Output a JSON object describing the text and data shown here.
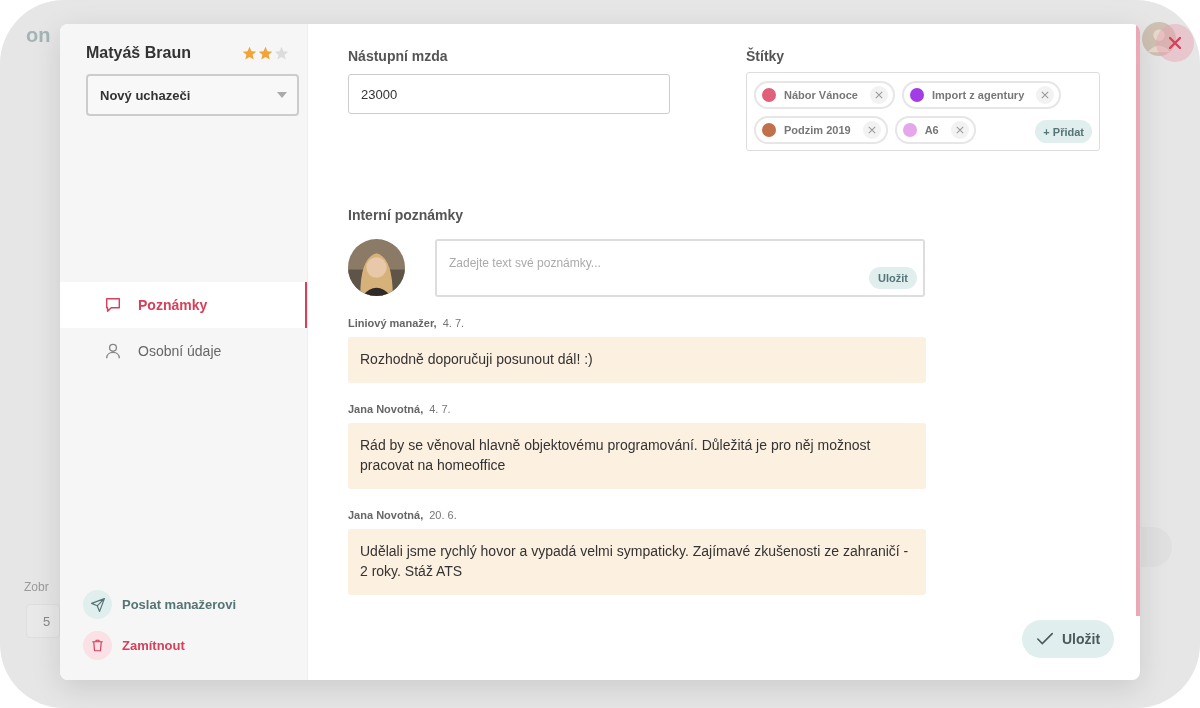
{
  "backdrop": {
    "logo": "on",
    "label": "Zobr",
    "select_value": "5"
  },
  "candidate": {
    "name": "Matyáš Braun",
    "stars": 2,
    "status": "Nový uchazeči"
  },
  "nav": [
    {
      "label": "Poznámky",
      "selected": true
    },
    {
      "label": "Osobní údaje",
      "selected": false
    }
  ],
  "actions": [
    {
      "label": "Poslat manažerovi",
      "kind": "send"
    },
    {
      "label": "Zamítnout",
      "kind": "reject"
    }
  ],
  "salary": {
    "label": "Nástupní mzda",
    "value": "23000"
  },
  "tags": {
    "label": "Štítky",
    "add_button": "+ Přidat",
    "items": [
      {
        "name": "Nábor Vánoce",
        "color": "#e0607a"
      },
      {
        "name": "Import z agentury",
        "color": "#a23de6"
      },
      {
        "name": "Podzim 2019",
        "color": "#c0704a"
      },
      {
        "name": "A6",
        "color": "#e6a6ea"
      }
    ]
  },
  "notes": {
    "label": "Interní poznámky",
    "placeholder": "Zadejte text své poznámky...",
    "save_button": "Uložit",
    "items": [
      {
        "author": "Liniový manažer,",
        "date": "4. 7.",
        "text": "Rozhodně doporučuji posunout dál! :)"
      },
      {
        "author": "Jana Novotná,",
        "date": "4. 7.",
        "text": "Rád by se věnoval hlavně objektovému programování. Důležitá je pro něj možnost pracovat na homeoffice"
      },
      {
        "author": "Jana Novotná,",
        "date": "20. 6.",
        "text": "Udělali jsme rychlý hovor a vypadá velmi sympaticky. Zajímavé zkušenosti ze zahraničí - 2 roky. Stáž ATS"
      }
    ]
  },
  "save_button": "Uložit"
}
